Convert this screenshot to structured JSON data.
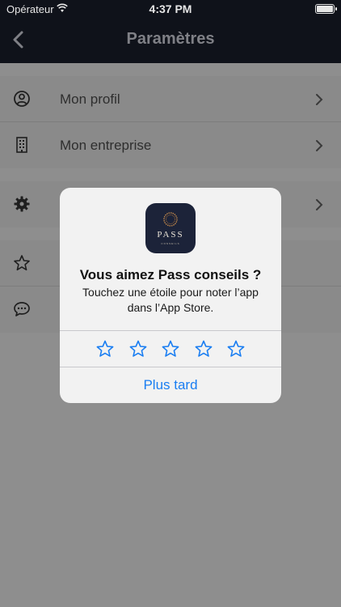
{
  "status_bar": {
    "carrier": "Opérateur",
    "time": "4:37 PM"
  },
  "navbar": {
    "title": "Paramètres",
    "back_icon": "chevron-left-icon"
  },
  "settings": {
    "items": [
      {
        "label": "Mon profil",
        "icon": "user-circle-icon"
      },
      {
        "label": "Mon entreprise",
        "icon": "building-icon"
      },
      {
        "label": "",
        "icon": "gear-icon"
      },
      {
        "label": "",
        "icon": "star-icon"
      },
      {
        "label": "",
        "icon": "chat-bubble-icon"
      }
    ]
  },
  "rating_alert": {
    "app_icon_word": "PASS",
    "app_icon_subword": "CONSEILS",
    "title": "Vous aimez Pass conseils ?",
    "message": "Touchez une étoile pour noter l’app dans l’App Store.",
    "star_count": 5,
    "later_label": "Plus tard"
  },
  "colors": {
    "nav_background": "#0f121a",
    "dim_background": "#8e8e8e",
    "alert_background": "#f2f2f2",
    "accent_blue": "#1a7ef2"
  }
}
